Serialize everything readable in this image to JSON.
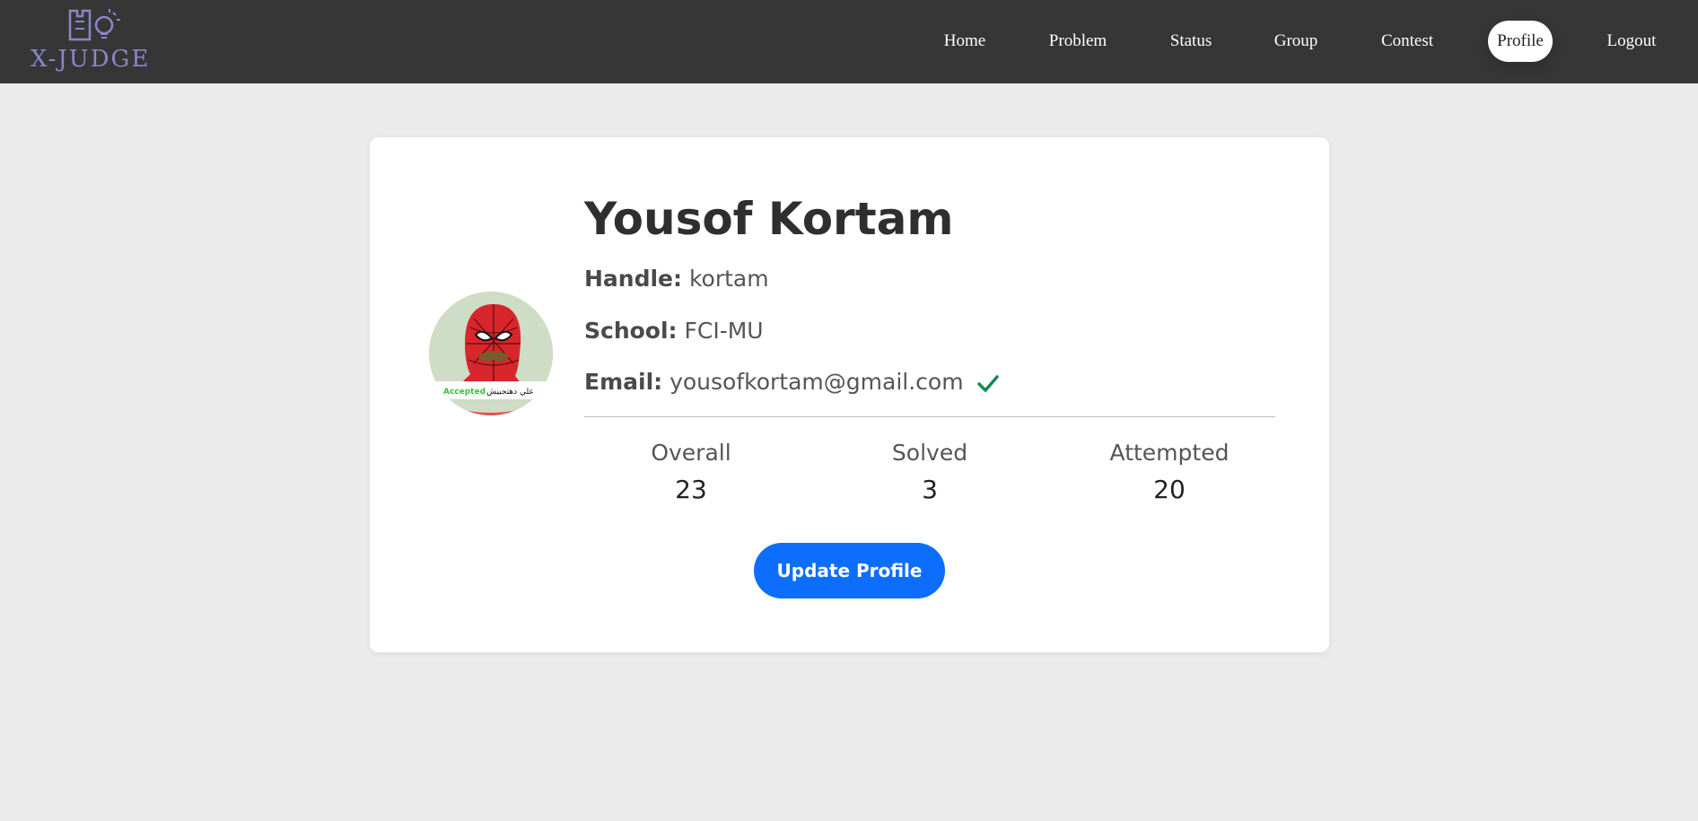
{
  "brand": {
    "logo_text": "X-JUDGE",
    "color": "#8b86c9"
  },
  "nav": {
    "items": [
      {
        "label": "Home"
      },
      {
        "label": "Problem"
      },
      {
        "label": "Status"
      },
      {
        "label": "Group"
      },
      {
        "label": "Contest"
      },
      {
        "label": "Profile",
        "active": true
      },
      {
        "label": "Logout"
      }
    ]
  },
  "profile": {
    "name": "Yousof Kortam",
    "handle_label": "Handle:",
    "handle": "kortam",
    "school_label": "School:",
    "school": "FCI-MU",
    "email_label": "Email:",
    "email": "yousofkortam@gmail.com",
    "email_verified_icon": "check-icon",
    "avatar_caption_green": "Accepted",
    "avatar_caption_ar": "علي دهتجبيش"
  },
  "stats": [
    {
      "label": "Overall",
      "value": "23"
    },
    {
      "label": "Solved",
      "value": "3"
    },
    {
      "label": "Attempted",
      "value": "20"
    }
  ],
  "actions": {
    "update_label": "Update Profile"
  },
  "colors": {
    "accent": "#0d6efd",
    "verified": "#198754",
    "navbar": "#363636"
  }
}
